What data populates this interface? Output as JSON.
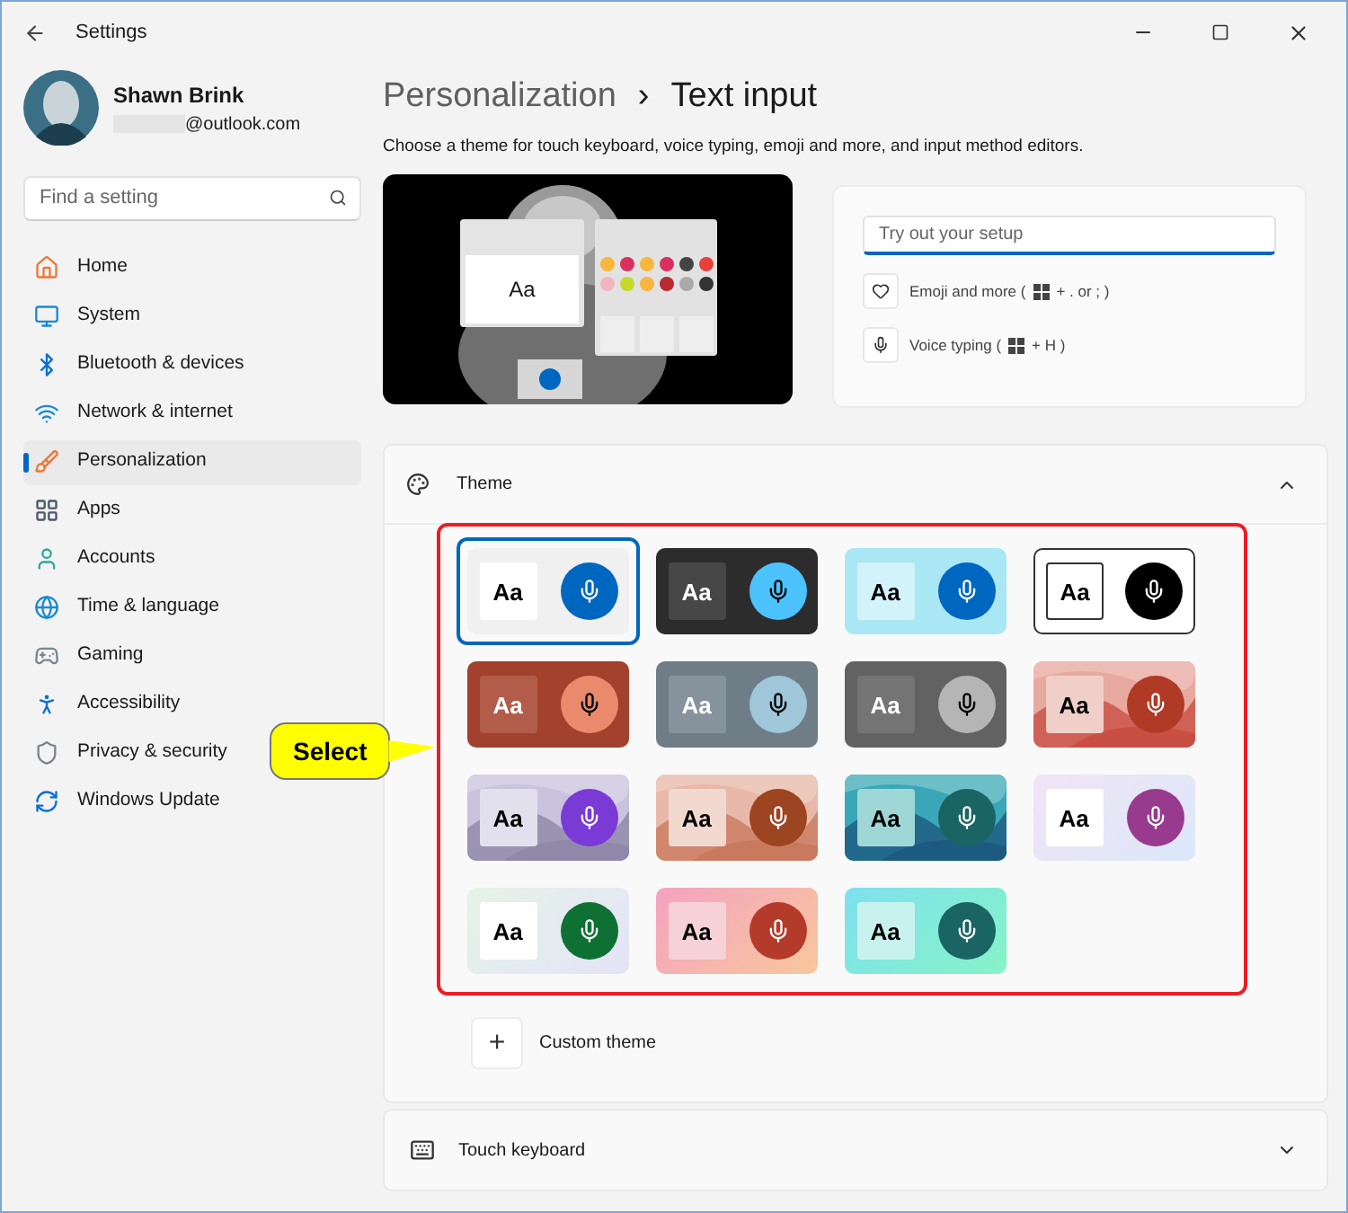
{
  "window": {
    "title": "Settings"
  },
  "account": {
    "name": "Shawn Brink",
    "email": "@outlook.com"
  },
  "search": {
    "placeholder": "Find a setting"
  },
  "sidebar": {
    "items": [
      {
        "label": "Home",
        "kind": "home",
        "selected": false
      },
      {
        "label": "System",
        "kind": "system",
        "selected": false
      },
      {
        "label": "Bluetooth & devices",
        "kind": "bluetooth",
        "selected": false
      },
      {
        "label": "Network & internet",
        "kind": "network",
        "selected": false
      },
      {
        "label": "Personalization",
        "kind": "personalization",
        "selected": true
      },
      {
        "label": "Apps",
        "kind": "apps",
        "selected": false
      },
      {
        "label": "Accounts",
        "kind": "accounts",
        "selected": false
      },
      {
        "label": "Time & language",
        "kind": "time",
        "selected": false
      },
      {
        "label": "Gaming",
        "kind": "gaming",
        "selected": false
      },
      {
        "label": "Accessibility",
        "kind": "accessibility",
        "selected": false
      },
      {
        "label": "Privacy & security",
        "kind": "privacy",
        "selected": false
      },
      {
        "label": "Windows Update",
        "kind": "update",
        "selected": false
      }
    ]
  },
  "breadcrumb": {
    "parent": "Personalization",
    "separator": "›",
    "current": "Text input"
  },
  "description": "Choose a theme for touch keyboard, voice typing, emoji and more, and input method editors.",
  "preview": {
    "key_label": "Aa"
  },
  "tryout": {
    "placeholder": "Try out your setup",
    "shortcuts": [
      {
        "kind": "emoji",
        "label": "Emoji and more (",
        "keys": "+ . or ; )"
      },
      {
        "kind": "voice",
        "label": "Voice typing (",
        "keys": "+ H )"
      }
    ]
  },
  "theme_section": {
    "title": "Theme",
    "expanded": true,
    "themes": [
      {
        "label": "Aa",
        "kind": "light",
        "color": "#0067c0",
        "selected": true
      },
      {
        "label": "Aa",
        "kind": "dark",
        "color": "#4cc2ff",
        "selected": false
      },
      {
        "label": "Aa",
        "kind": "aqua",
        "color": "#0067c0",
        "selected": false
      },
      {
        "label": "Aa",
        "kind": "contrast",
        "color": "#000000",
        "selected": false
      },
      {
        "label": "Aa",
        "kind": "rust",
        "color": "#e98a6c",
        "selected": false
      },
      {
        "label": "Aa",
        "kind": "slate",
        "color": "#9fc6d9",
        "selected": false
      },
      {
        "label": "Aa",
        "kind": "graphite",
        "color": "#b5b5b5",
        "selected": false
      },
      {
        "label": "Aa",
        "kind": "coral",
        "color": "#b03a26",
        "selected": false
      },
      {
        "label": "Aa",
        "kind": "lavender",
        "color": "#7a3ad6",
        "selected": false
      },
      {
        "label": "Aa",
        "kind": "peach",
        "color": "#9c4520",
        "selected": false
      },
      {
        "label": "Aa",
        "kind": "lagoon",
        "color": "#1b6464",
        "selected": false
      },
      {
        "label": "Aa",
        "kind": "lilac",
        "color": "#983a8e",
        "selected": false
      },
      {
        "label": "Aa",
        "kind": "mint",
        "color": "#0f7033",
        "selected": false
      },
      {
        "label": "Aa",
        "kind": "sunset",
        "color": "#b43a2a",
        "selected": false
      },
      {
        "label": "Aa",
        "kind": "cyan",
        "color": "#1b6464",
        "selected": false
      }
    ],
    "custom": {
      "symbol": "+",
      "label": "Custom theme"
    }
  },
  "touch_keyboard": {
    "title": "Touch keyboard",
    "expanded": false
  },
  "callout": {
    "text": "Select"
  }
}
